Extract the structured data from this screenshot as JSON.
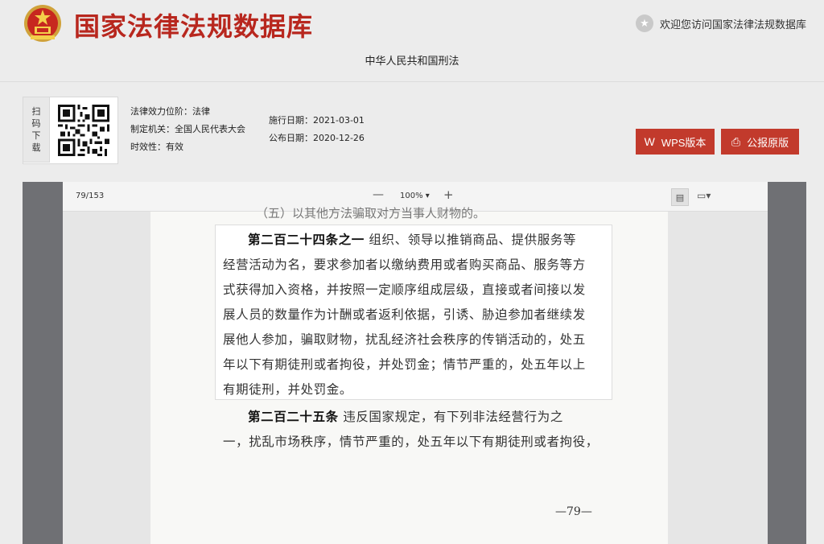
{
  "header": {
    "site_title": "国家法律法规数据库",
    "welcome": "欢迎您访问国家法律法规数据库",
    "law_title": "中华人民共和国刑法"
  },
  "qr": {
    "label": [
      "扫",
      "码",
      "下",
      "载"
    ]
  },
  "meta": {
    "level": "法律效力位阶：法律",
    "authority": "制定机关：全国人民代表大会",
    "status": "时效性：有效",
    "effective_date": "施行日期：2021-03-01",
    "publish_date": "公布日期：2020-12-26"
  },
  "buttons": {
    "wps": "WPS版本",
    "original": "公报原版"
  },
  "viewer": {
    "page_count": "79/153",
    "zoom": "100%",
    "partial_line": "（五）以其他方法骗取对方当事人财物的。",
    "highlight_lines": [
      {
        "head": "第二百二十四条之一",
        "text": "  组织、领导以推销商品、提供服务等"
      },
      {
        "head": "",
        "text": "经营活动为名，要求参加者以缴纳费用或者购买商品、服务等方"
      },
      {
        "head": "",
        "text": "式获得加入资格，并按照一定顺序组成层级，直接或者间接以发"
      },
      {
        "head": "",
        "text": "展人员的数量作为计酬或者返利依据，引诱、胁迫参加者继续发"
      },
      {
        "head": "",
        "text": "展他人参加，骗取财物，扰乱经济社会秩序的传销活动的，处五"
      },
      {
        "head": "",
        "text": "年以下有期徒刑或者拘役，并处罚金；情节严重的，处五年以上"
      },
      {
        "head": "",
        "text": "有期徒刑，并处罚金。"
      }
    ],
    "next_lines": [
      {
        "head": "第二百二十五条",
        "text": "  违反国家规定，有下列非法经营行为之"
      },
      {
        "head": "",
        "text": "一，扰乱市场秩序，情节严重的，处五年以下有期徒刑或者拘役，"
      }
    ],
    "page_number": "—79—"
  },
  "colors": {
    "brand_red": "#b8271e",
    "button_red": "#c23a2c"
  }
}
